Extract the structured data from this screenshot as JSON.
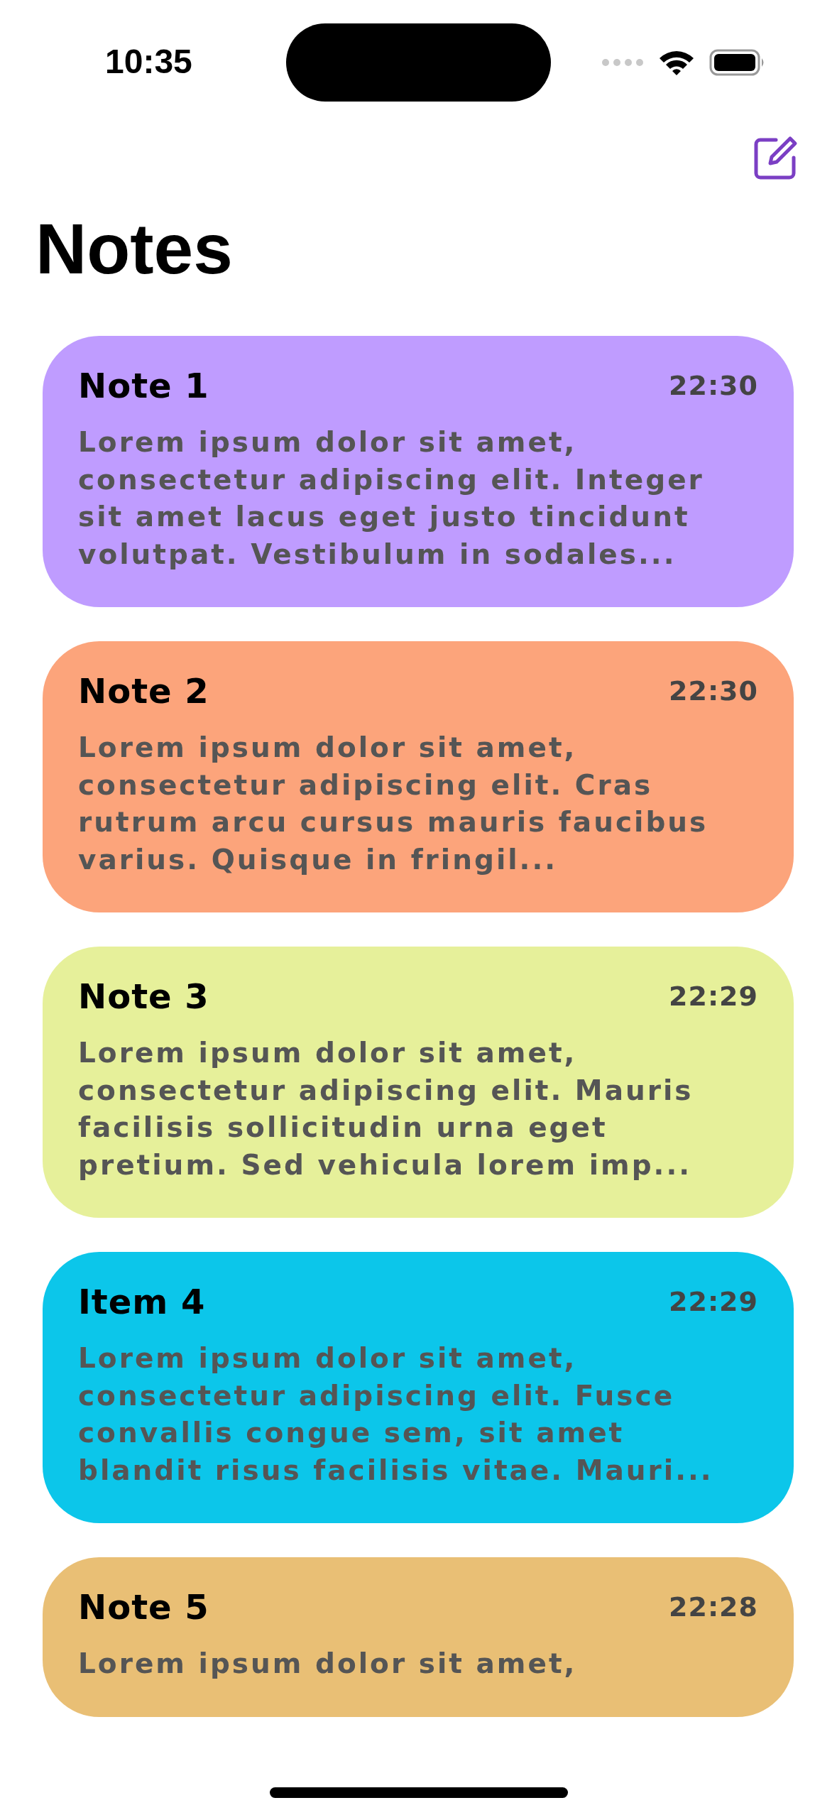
{
  "status_bar": {
    "time": "10:35"
  },
  "title": "Notes",
  "notes": [
    {
      "title": "Note 1",
      "time": "22:30",
      "color": "#bf9cff",
      "body": "Lorem ipsum dolor sit amet, consectetur adipiscing elit. Integer sit amet lacus eget justo tincidunt volutpat. Vestibulum in sodales..."
    },
    {
      "title": "Note 2",
      "time": "22:30",
      "color": "#fca47b",
      "body": "Lorem ipsum dolor sit amet, consectetur adipiscing elit. Cras rutrum arcu cursus mauris faucibus varius. Quisque in fringil..."
    },
    {
      "title": "Note 3",
      "time": "22:29",
      "color": "#e6f09a",
      "body": "Lorem ipsum dolor sit amet, consectetur adipiscing elit. Mauris facilisis sollicitudin urna eget pretium. Sed vehicula lorem imp..."
    },
    {
      "title": "Item 4",
      "time": "22:29",
      "color": "#0cc6ea",
      "body": "Lorem ipsum dolor sit amet, consectetur adipiscing elit. Fusce convallis congue sem, sit amet blandit risus facilisis vitae. Mauri..."
    },
    {
      "title": "Note 5",
      "time": "22:28",
      "color": "#e9bf75",
      "body": "Lorem ipsum dolor sit amet,"
    }
  ]
}
